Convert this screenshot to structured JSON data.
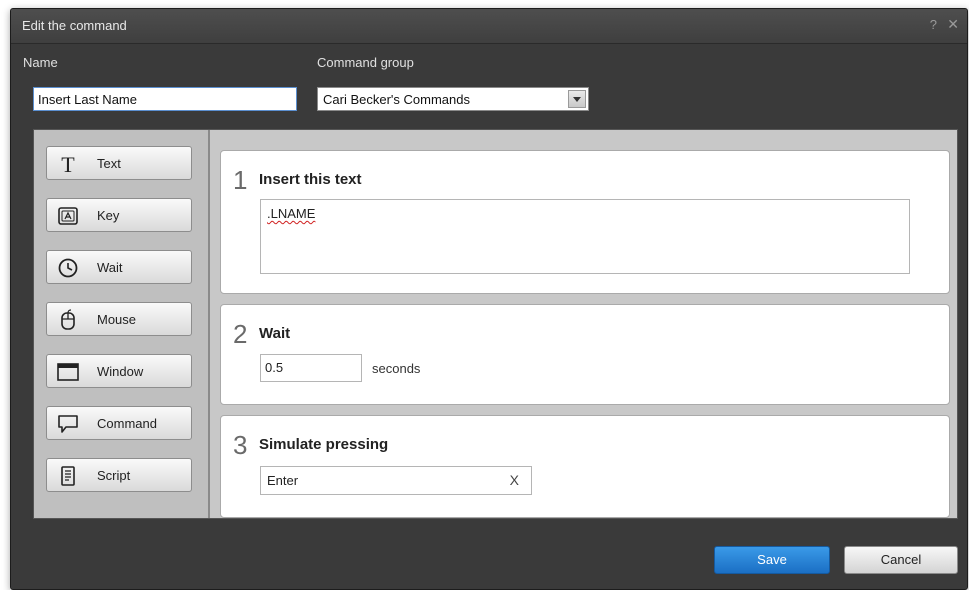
{
  "dialog": {
    "title": "Edit the command",
    "help": "?",
    "close": "✕"
  },
  "form": {
    "name_label": "Name",
    "name_value": "Insert Last Name",
    "group_label": "Command group",
    "group_value": "Cari Becker's Commands"
  },
  "toolbox": [
    {
      "label": "Text",
      "icon": "text-icon"
    },
    {
      "label": "Key",
      "icon": "key-icon"
    },
    {
      "label": "Wait",
      "icon": "clock-icon"
    },
    {
      "label": "Mouse",
      "icon": "mouse-icon"
    },
    {
      "label": "Window",
      "icon": "window-icon"
    },
    {
      "label": "Command",
      "icon": "speech-bubble-icon"
    },
    {
      "label": "Script",
      "icon": "script-icon"
    }
  ],
  "steps": [
    {
      "number": "1",
      "title": "Insert this text",
      "text": ".LNAME"
    },
    {
      "number": "2",
      "title": "Wait",
      "value": "0.5",
      "unit": "seconds"
    },
    {
      "number": "3",
      "title": "Simulate pressing",
      "value": "Enter",
      "clear": "X"
    }
  ],
  "footer": {
    "save": "Save",
    "cancel": "Cancel"
  },
  "colors": {
    "save_button": "#2a86dc",
    "dialog_bg": "#3a3a3a",
    "workarea_bg": "#c8c8c8"
  }
}
